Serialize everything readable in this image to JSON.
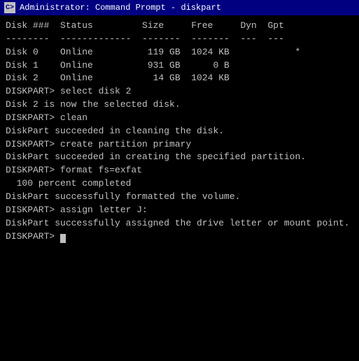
{
  "titleBar": {
    "icon": "C>",
    "title": "Administrator: Command Prompt - diskpart"
  },
  "console": {
    "lines": [
      {
        "id": "disk-header-1",
        "text": "Disk ###  Status         Size     Free     Dyn  Gpt"
      },
      {
        "id": "disk-header-2",
        "text": "--------  -------------  -------  -------  ---  ---"
      },
      {
        "id": "disk0",
        "text": "Disk 0    Online          119 GB  1024 KB            *"
      },
      {
        "id": "disk1",
        "text": "Disk 1    Online          931 GB      0 B"
      },
      {
        "id": "disk2",
        "text": "Disk 2    Online           14 GB  1024 KB"
      },
      {
        "id": "blank1",
        "text": ""
      },
      {
        "id": "cmd-select",
        "text": "DISKPART> select disk 2"
      },
      {
        "id": "blank2",
        "text": ""
      },
      {
        "id": "msg-selected",
        "text": "Disk 2 is now the selected disk."
      },
      {
        "id": "blank3",
        "text": ""
      },
      {
        "id": "cmd-clean",
        "text": "DISKPART> clean"
      },
      {
        "id": "blank4",
        "text": ""
      },
      {
        "id": "msg-clean",
        "text": "DiskPart succeeded in cleaning the disk."
      },
      {
        "id": "blank5",
        "text": ""
      },
      {
        "id": "cmd-create",
        "text": "DISKPART> create partition primary"
      },
      {
        "id": "blank6",
        "text": ""
      },
      {
        "id": "msg-create",
        "text": "DiskPart succeeded in creating the specified partition."
      },
      {
        "id": "blank7",
        "text": ""
      },
      {
        "id": "cmd-format",
        "text": "DISKPART> format fs=exfat"
      },
      {
        "id": "blank8",
        "text": ""
      },
      {
        "id": "msg-format-progress",
        "text": "  100 percent completed"
      },
      {
        "id": "blank9",
        "text": ""
      },
      {
        "id": "msg-format-done",
        "text": "DiskPart successfully formatted the volume."
      },
      {
        "id": "blank10",
        "text": ""
      },
      {
        "id": "cmd-assign",
        "text": "DISKPART> assign letter J:"
      },
      {
        "id": "blank11",
        "text": ""
      },
      {
        "id": "msg-assign",
        "text": "DiskPart successfully assigned the drive letter or mount point."
      },
      {
        "id": "blank12",
        "text": ""
      },
      {
        "id": "cmd-prompt",
        "text": "DISKPART> "
      }
    ]
  }
}
